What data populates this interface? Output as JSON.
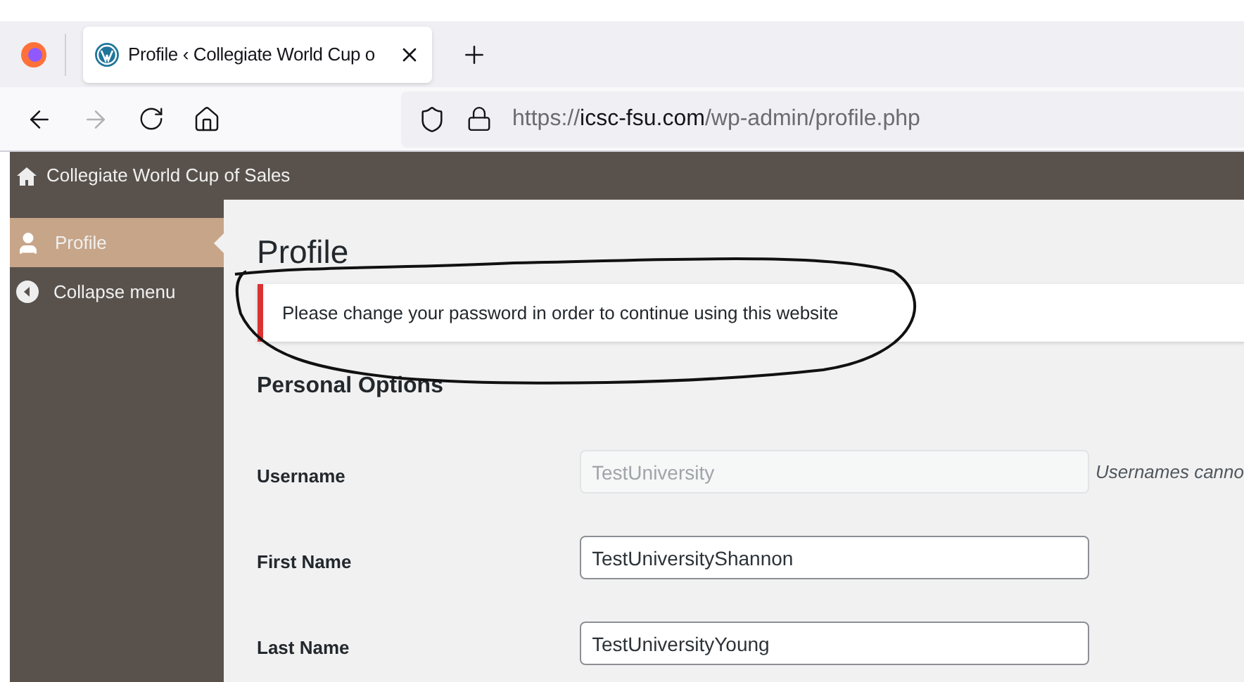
{
  "browser": {
    "tab": {
      "title": "Profile ‹ Collegiate World Cup o",
      "selected": true
    },
    "url": {
      "host": "icsc-fsu.com",
      "path": "/wp-admin/profile.php",
      "scheme": "https://"
    }
  },
  "admin_bar": {
    "site_name": "Collegiate World Cup of Sales"
  },
  "sidebar": {
    "items": [
      {
        "label": "Profile",
        "kind": "user",
        "selected": true
      },
      {
        "label": "Collapse menu",
        "kind": "collapse",
        "selected": false
      }
    ]
  },
  "page": {
    "title": "Profile",
    "notice": "Please change your password in order to continue using this website",
    "section": "Personal Options",
    "fields": [
      {
        "label": "Username",
        "value": "TestUniversity",
        "disabled": true,
        "description": "Usernames canno"
      },
      {
        "label": "First Name",
        "value": "TestUniversityShannon",
        "disabled": false
      },
      {
        "label": "Last Name",
        "value": "TestUniversityYoung",
        "disabled": false
      }
    ]
  }
}
